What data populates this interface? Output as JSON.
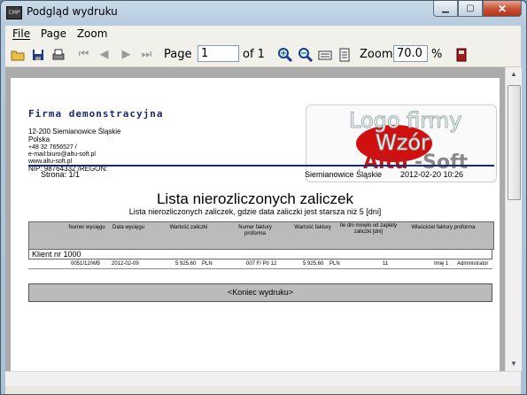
{
  "window": {
    "title": "Podgląd wydruku",
    "app_icon_text": "CMP"
  },
  "menu": {
    "file": "File",
    "page": "Page",
    "zoom": "Zoom"
  },
  "toolbar": {
    "page_label": "Page",
    "page_value": "1",
    "of_label": "of 1",
    "zoom_label": "Zoom",
    "zoom_value": "70.0",
    "percent": "%"
  },
  "report": {
    "firm_name": "Firma demonstracyjna",
    "address": {
      "postal_city": "12-200     Siemianowice Śląskie",
      "country": "Polska",
      "phone": "+48 32 7656527                /",
      "email": "e-mail:biuro@altu-soft.pl",
      "www": "www.altu-soft.pl",
      "nip_regon": "NIP: 98764332        /REGON:"
    },
    "logo": {
      "line1": "Logo firmy",
      "line2": "Wzór",
      "altu": "Altu",
      "soft": "-Soft"
    },
    "page_info": "Strona: 1/1",
    "place": "Siemianowice Śląskie",
    "datetime": "2012-02-20 10:26",
    "title": "Lista nierozliczonych zaliczek",
    "subtitle": "Lista nierozliczonych zaliczek, gdzie data zaliczki jest starsza niż 5 [dni]",
    "columns": [
      "Numer wycięgu",
      "Data wycięgu",
      "Wartość zaliczki",
      "Numer faktury proforma",
      "Wartość faktury",
      "Ile dni minęło od zapłaty zaliczki [dni]",
      "Właściciel faktury proforma"
    ],
    "group_label": "Klient nr 1000",
    "rows": [
      {
        "number": "0051/12/WB",
        "date": "2012-02-09",
        "amount": "5 925,60",
        "currency1": "PLN",
        "proforma": "007 F/ PI/ 12",
        "invoice_value": "5 925,60",
        "currency2": "PLN",
        "days": "11",
        "owner_first": "Imię 1",
        "owner_last": "Administrator"
      }
    ],
    "end_label": "<Koniec wydruku>"
  }
}
